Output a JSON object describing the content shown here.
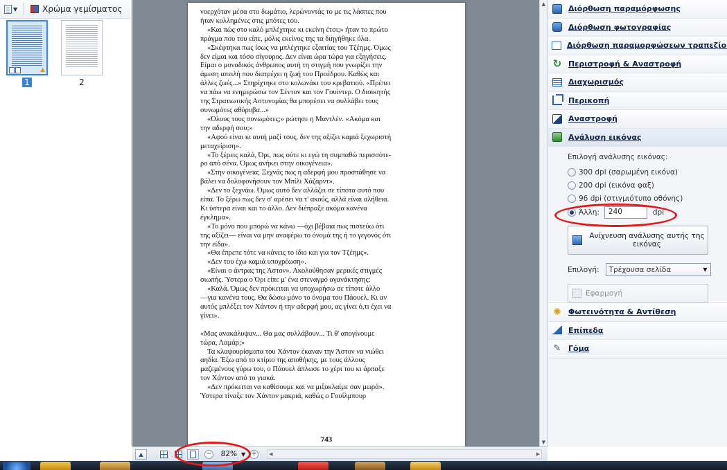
{
  "left_panel": {
    "fill_color_label": "Χρώμα γεμίσματος",
    "thumbnails": [
      {
        "number": "1",
        "selected": true
      },
      {
        "number": "2",
        "selected": false
      }
    ]
  },
  "document": {
    "paragraphs": [
      {
        "indent": false,
        "gap": false,
        "lines": [
          "νοερχόταν μέσα στο δωμάτιο, λερώνοντάς το με τις λάσπες που",
          "ήταν κολλημένες στις μπότες του."
        ]
      },
      {
        "indent": true,
        "gap": false,
        "lines": [
          "«Και πώς στο καλό μπλέχτηκε κι εκείνη έτσι;» ήταν το πρώτο",
          "πράγμα που του είπε, μόλις εκείνος της τα διηγήθηκε όλα."
        ]
      },
      {
        "indent": true,
        "gap": false,
        "lines": [
          "«Σκέφτηκα πως ίσως να μπλέχτηκε εξαιτίας του Τζέημς. Όμως",
          "δεν είμαι και τόσο σίγουρος. Δεν είναι ώρα τώρα για εξηγήσεις.",
          "Είμαι ο μοναδικός άνθρωπος αυτή τη στιγμή που γνωρίζει την",
          "άμεση απειλή που διατρέχει η ζωή του Προέδρου. Καθώς και",
          "άλλες ζωές...» Στηρίχτηκε στο κολωνάκι του κρεβατιού. «Πρέπει",
          "να πάω να ενημερώσω τον Σέντον και τον Γουίντερ. Ο διοικητής",
          "της Στρατιωτικής Αστυνομίας θα μπορέσει να συλλάβει τους",
          "συνωμότες αθόρυβα...»"
        ]
      },
      {
        "indent": true,
        "gap": false,
        "lines": [
          "«Όλους τους συνωμότες;» ρώτησε η Μαντλέν. «Ακόμα και",
          "την αδερφή σου;»"
        ]
      },
      {
        "indent": true,
        "gap": false,
        "lines": [
          "«Αφού είναι κι αυτή μαζί τους, δεν της αξίζει καμιά ξεχωριστή",
          "μεταχείριση»."
        ]
      },
      {
        "indent": true,
        "gap": false,
        "lines": [
          "«Το ξέρεις καλά, Όρι, πως ούτε κι εγώ τη συμπαθώ περισσότε-",
          "ρο από σένα. Όμως ανήκει στην οικογένεια»."
        ]
      },
      {
        "indent": true,
        "gap": false,
        "lines": [
          "«Στην οικογένεια; Ξεχνάς πως η αδερφή μου προσπάθησε να",
          "βάλει να δολοφονήσουν τον Μπίλι Χάζαρντ»."
        ]
      },
      {
        "indent": true,
        "gap": false,
        "lines": [
          "«Δεν το ξεχνάω. Όμως αυτό δεν αλλάζει σε τίποτα αυτό που",
          "είπα. Το ξέρω πως δεν σ' αρέσει να τ' ακούς, αλλά είναι αλήθεια.",
          "Κι ύστερα είναι και το άλλο. Δεν διέπραξε ακόμα κανένα",
          "έγκλημα»."
        ]
      },
      {
        "indent": true,
        "gap": false,
        "lines": [
          "«Το μόνο που μπορώ να κάνω —όχι βέβαια πως πιστεύω ότι",
          "της αξίζει— είναι να μην αναφέρω το όνομά της ή το γεγονός ότι",
          "την είδα»."
        ]
      },
      {
        "indent": true,
        "gap": false,
        "lines": [
          "«Θα έπρεπε τότε να κάνεις το ίδιο και για τον Τζέημς»."
        ]
      },
      {
        "indent": true,
        "gap": false,
        "lines": [
          "«Δεν του έχω καμιά υποχρέωση»."
        ]
      },
      {
        "indent": true,
        "gap": false,
        "lines": [
          "«Είναι ο άντρας της Άστον». Ακολούθησαν μερικές στιγμές",
          "σιωπής. Ύστερα ο Όρι είπε μ' ένα στεναγμό αγανάκτησης:"
        ]
      },
      {
        "indent": true,
        "gap": false,
        "lines": [
          "«Καλά. Όμως δεν πρόκειται να υποχωρήσω σε τίποτε άλλο",
          "—για κανένα τους. Θα δώσω μόνο το όνομα του Πάουελ. Κι αν",
          "αυτός μπλέξει τον Χάντον ή την αδερφή μου, ας γίνει ό,τι έχει να",
          "γίνει»."
        ]
      },
      {
        "indent": false,
        "gap": true,
        "lines": [
          "«Μας ανακάλυψαν... Θα μας συλλάβουν... Τι θ' απογίνουμε",
          "τώρα, Λαμάρ;»"
        ]
      },
      {
        "indent": true,
        "gap": false,
        "lines": [
          "Τα κλαψουρίσματα του Χάντον έκαναν την Άστον να νιώθει",
          "αηδία. Έξω από το κτίριο της αποθήκης, με τους άλλους",
          "μαζεμένους γύρω του, ο Πάουελ άπλωσε το χέρι του κι άρπαξε",
          "τον Χάντον από το γιακά."
        ]
      },
      {
        "indent": true,
        "gap": false,
        "lines": [
          "«Δεν πρόκειται να καθίσουμε και να μιξοκλαίμε σαν μωρά».",
          "Ύστερα τίναξε τον Χάντον μακριά, καθώς ο Γουίλμπουρ"
        ]
      }
    ],
    "page_number": "743"
  },
  "right_panel": {
    "items_top": [
      {
        "label": "Διόρθωση παραμόρφωσης",
        "icon": "deskew-icon"
      },
      {
        "label": "Διόρθωση φωτογραφίας",
        "icon": "photo-correction-icon"
      },
      {
        "label": "Διόρθωση παραμορφώσεων τραπεζίου",
        "icon": "trapezoid-icon"
      },
      {
        "label": "Περιστροφή & Αναστροφή",
        "icon": "rotate-icon"
      },
      {
        "label": "Διαχωρισμός",
        "icon": "split-icon"
      },
      {
        "label": "Περικοπή",
        "icon": "crop-icon"
      },
      {
        "label": "Αναστροφή",
        "icon": "invert-icon"
      },
      {
        "label": "Ανάλυση εικόνας",
        "icon": "resolution-icon"
      }
    ],
    "analysis": {
      "title": "Επιλογή ανάλυσης εικόνας:",
      "options": [
        {
          "label": "300 dpi (σαρωμένη εικόνα)",
          "checked": false
        },
        {
          "label": "200 dpi (εικόνα φαξ)",
          "checked": false
        },
        {
          "label": "96 dpi (στιγμιότυπο οθόνης)",
          "checked": false
        }
      ],
      "other_label": "Άλλη:",
      "other_value": "240",
      "other_unit": "dpi",
      "detect_button": "Ανίχνευση ανάλυσης αυτής της εικόνας",
      "selection_label": "Επιλογή:",
      "selection_value": "Τρέχουσα σελίδα",
      "apply_button": "Εφαρμογή"
    },
    "items_bottom": [
      {
        "label": "Φωτεινότητα & Αντίθεση",
        "icon": "brightness-icon"
      },
      {
        "label": "Επίπεδα",
        "icon": "levels-icon"
      },
      {
        "label": "Γόμα",
        "icon": "eraser-icon"
      }
    ]
  },
  "bottom_bar": {
    "zoom_value": "82%"
  }
}
